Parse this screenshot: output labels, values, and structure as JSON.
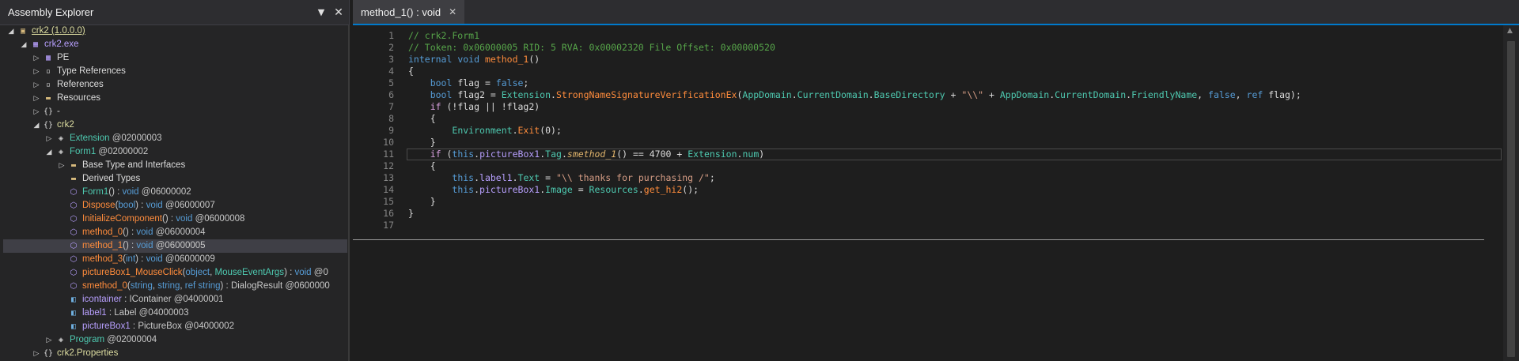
{
  "colors": {
    "background": "#1e1e1e",
    "panel": "#252526",
    "accent": "#007acc",
    "selected_row": "#3f3f46",
    "comment": "#57a64a",
    "keyword": "#569cd6",
    "type": "#4ec9b0",
    "method": "#ff8c3c"
  },
  "explorer": {
    "title": "Assembly Explorer",
    "dropdown_icon": "chevron-down-icon",
    "close_icon": "close-icon",
    "tree": [
      {
        "indent": 0,
        "arrow": "expanded",
        "icon": "assembly-icon",
        "parts": [
          {
            "t": "crk2 (1.0.0.0)",
            "c": "c-yellow u"
          }
        ]
      },
      {
        "indent": 1,
        "arrow": "expanded",
        "icon": "module-icon",
        "parts": [
          {
            "t": "crk2.exe",
            "c": "c-purple"
          }
        ]
      },
      {
        "indent": 2,
        "arrow": "collapsed",
        "icon": "pe-icon",
        "parts": [
          {
            "t": "PE",
            "c": "c-plain"
          }
        ]
      },
      {
        "indent": 2,
        "arrow": "collapsed",
        "icon": "type-ref-icon",
        "parts": [
          {
            "t": "Type References",
            "c": "c-plain"
          }
        ]
      },
      {
        "indent": 2,
        "arrow": "collapsed",
        "icon": "references-icon",
        "parts": [
          {
            "t": "References",
            "c": "c-plain"
          }
        ]
      },
      {
        "indent": 2,
        "arrow": "collapsed",
        "icon": "folder-icon",
        "parts": [
          {
            "t": "Resources",
            "c": "c-plain"
          }
        ]
      },
      {
        "indent": 2,
        "arrow": "collapsed",
        "icon": "namespace-icon",
        "parts": [
          {
            "t": "-",
            "c": "c-plain"
          }
        ]
      },
      {
        "indent": 2,
        "arrow": "expanded",
        "icon": "namespace-icon",
        "parts": [
          {
            "t": "crk2",
            "c": "c-yellow"
          }
        ]
      },
      {
        "indent": 3,
        "arrow": "collapsed",
        "icon": "class-icon",
        "parts": [
          {
            "t": "Extension",
            "c": "c-teal"
          },
          {
            "t": " @02000003",
            "c": "c-grey"
          }
        ]
      },
      {
        "indent": 3,
        "arrow": "expanded",
        "icon": "class-icon",
        "parts": [
          {
            "t": "Form1",
            "c": "c-teal"
          },
          {
            "t": " @02000002",
            "c": "c-grey"
          }
        ]
      },
      {
        "indent": 4,
        "arrow": "collapsed",
        "icon": "folder-icon",
        "parts": [
          {
            "t": "Base Type and Interfaces",
            "c": "c-plain"
          }
        ]
      },
      {
        "indent": 4,
        "arrow": "none",
        "icon": "folder-icon",
        "parts": [
          {
            "t": "Derived Types",
            "c": "c-plain"
          }
        ]
      },
      {
        "indent": 4,
        "arrow": "none",
        "icon": "method-icon",
        "parts": [
          {
            "t": "Form1",
            "c": "c-teal"
          },
          {
            "t": "() : ",
            "c": "c-grey"
          },
          {
            "t": "void",
            "c": "c-blue"
          },
          {
            "t": " @06000002",
            "c": "c-grey"
          }
        ]
      },
      {
        "indent": 4,
        "arrow": "none",
        "icon": "method-icon",
        "parts": [
          {
            "t": "Dispose",
            "c": "c-orange"
          },
          {
            "t": "(",
            "c": "c-grey"
          },
          {
            "t": "bool",
            "c": "c-blue"
          },
          {
            "t": ") : ",
            "c": "c-grey"
          },
          {
            "t": "void",
            "c": "c-blue"
          },
          {
            "t": " @06000007",
            "c": "c-grey"
          }
        ]
      },
      {
        "indent": 4,
        "arrow": "none",
        "icon": "method-icon",
        "parts": [
          {
            "t": "InitializeComponent",
            "c": "c-orange"
          },
          {
            "t": "() : ",
            "c": "c-grey"
          },
          {
            "t": "void",
            "c": "c-blue"
          },
          {
            "t": " @06000008",
            "c": "c-grey"
          }
        ]
      },
      {
        "indent": 4,
        "arrow": "none",
        "icon": "method-icon",
        "parts": [
          {
            "t": "method_0",
            "c": "c-orange"
          },
          {
            "t": "() : ",
            "c": "c-grey"
          },
          {
            "t": "void",
            "c": "c-blue"
          },
          {
            "t": " @06000004",
            "c": "c-grey"
          }
        ]
      },
      {
        "indent": 4,
        "arrow": "none",
        "icon": "method-icon",
        "selected": true,
        "parts": [
          {
            "t": "method_1",
            "c": "c-orange"
          },
          {
            "t": "() : ",
            "c": "c-grey"
          },
          {
            "t": "void",
            "c": "c-blue"
          },
          {
            "t": " @06000005",
            "c": "c-grey"
          }
        ]
      },
      {
        "indent": 4,
        "arrow": "none",
        "icon": "method-icon",
        "parts": [
          {
            "t": "method_3",
            "c": "c-orange"
          },
          {
            "t": "(",
            "c": "c-grey"
          },
          {
            "t": "int",
            "c": "c-blue"
          },
          {
            "t": ") : ",
            "c": "c-grey"
          },
          {
            "t": "void",
            "c": "c-blue"
          },
          {
            "t": " @06000009",
            "c": "c-grey"
          }
        ]
      },
      {
        "indent": 4,
        "arrow": "none",
        "icon": "method-icon",
        "parts": [
          {
            "t": "pictureBox1_MouseClick",
            "c": "c-orange"
          },
          {
            "t": "(",
            "c": "c-grey"
          },
          {
            "t": "object",
            "c": "c-blue"
          },
          {
            "t": ", ",
            "c": "c-grey"
          },
          {
            "t": "MouseEventArgs",
            "c": "c-teal"
          },
          {
            "t": ") : ",
            "c": "c-grey"
          },
          {
            "t": "void",
            "c": "c-blue"
          },
          {
            "t": " @0",
            "c": "c-grey"
          }
        ]
      },
      {
        "indent": 4,
        "arrow": "none",
        "icon": "method-icon",
        "parts": [
          {
            "t": "smethod_0",
            "c": "c-orange"
          },
          {
            "t": "(",
            "c": "c-grey"
          },
          {
            "t": "string",
            "c": "c-blue"
          },
          {
            "t": ", ",
            "c": "c-grey"
          },
          {
            "t": "string",
            "c": "c-blue"
          },
          {
            "t": ", ",
            "c": "c-grey"
          },
          {
            "t": "ref string",
            "c": "c-blue"
          },
          {
            "t": ") : DialogResult @0600000",
            "c": "c-grey"
          }
        ]
      },
      {
        "indent": 4,
        "arrow": "none",
        "icon": "field-icon",
        "parts": [
          {
            "t": "icontainer",
            "c": "c-purple"
          },
          {
            "t": " : IContainer @04000001",
            "c": "c-grey"
          }
        ]
      },
      {
        "indent": 4,
        "arrow": "none",
        "icon": "field-icon",
        "parts": [
          {
            "t": "label1",
            "c": "c-purple"
          },
          {
            "t": " : Label @04000003",
            "c": "c-grey"
          }
        ]
      },
      {
        "indent": 4,
        "arrow": "none",
        "icon": "field-icon",
        "parts": [
          {
            "t": "pictureBox1",
            "c": "c-purple"
          },
          {
            "t": " : PictureBox @04000002",
            "c": "c-grey"
          }
        ]
      },
      {
        "indent": 3,
        "arrow": "collapsed",
        "icon": "class-icon",
        "parts": [
          {
            "t": "Program",
            "c": "c-teal"
          },
          {
            "t": " @02000004",
            "c": "c-grey"
          }
        ]
      },
      {
        "indent": 2,
        "arrow": "collapsed",
        "icon": "namespace-icon",
        "parts": [
          {
            "t": "crk2.Properties",
            "c": "c-yellow"
          }
        ]
      }
    ]
  },
  "editor": {
    "tab_title": "method_1() : void",
    "tab_close_icon": "close-icon",
    "current_line": 11,
    "lines": [
      {
        "n": "1",
        "parts": [
          {
            "t": "// crk2.Form1",
            "c": "c-com"
          }
        ]
      },
      {
        "n": "2",
        "parts": [
          {
            "t": "// Token: 0x06000005 RID: 5 RVA: 0x00002320 File Offset: 0x00000520",
            "c": "c-com"
          }
        ]
      },
      {
        "n": "3",
        "parts": [
          {
            "t": "internal",
            "c": "c-key"
          },
          {
            "t": " ",
            "c": "c-plain"
          },
          {
            "t": "void",
            "c": "c-key"
          },
          {
            "t": " ",
            "c": "c-plain"
          },
          {
            "t": "method_1",
            "c": "c-mname"
          },
          {
            "t": "()",
            "c": "c-plain"
          }
        ]
      },
      {
        "n": "4",
        "parts": [
          {
            "t": "{",
            "c": "c-plain"
          }
        ]
      },
      {
        "n": "5",
        "parts": [
          {
            "t": "    ",
            "c": "c-plain"
          },
          {
            "t": "bool",
            "c": "c-key"
          },
          {
            "t": " flag = ",
            "c": "c-plain"
          },
          {
            "t": "false",
            "c": "c-key"
          },
          {
            "t": ";",
            "c": "c-plain"
          }
        ]
      },
      {
        "n": "6",
        "parts": [
          {
            "t": "    ",
            "c": "c-plain"
          },
          {
            "t": "bool",
            "c": "c-key"
          },
          {
            "t": " flag2 = ",
            "c": "c-plain"
          },
          {
            "t": "Extension",
            "c": "c-type"
          },
          {
            "t": ".",
            "c": "c-plain"
          },
          {
            "t": "StrongNameSignatureVerificationEx",
            "c": "c-mname"
          },
          {
            "t": "(",
            "c": "c-plain"
          },
          {
            "t": "AppDomain",
            "c": "c-type"
          },
          {
            "t": ".",
            "c": "c-plain"
          },
          {
            "t": "CurrentDomain",
            "c": "c-type"
          },
          {
            "t": ".",
            "c": "c-plain"
          },
          {
            "t": "BaseDirectory",
            "c": "c-type"
          },
          {
            "t": " + ",
            "c": "c-plain"
          },
          {
            "t": "\"\\\\\"",
            "c": "c-str"
          },
          {
            "t": " + ",
            "c": "c-plain"
          },
          {
            "t": "AppDomain",
            "c": "c-type"
          },
          {
            "t": ".",
            "c": "c-plain"
          },
          {
            "t": "CurrentDomain",
            "c": "c-type"
          },
          {
            "t": ".",
            "c": "c-plain"
          },
          {
            "t": "FriendlyName",
            "c": "c-type"
          },
          {
            "t": ", ",
            "c": "c-plain"
          },
          {
            "t": "false",
            "c": "c-key"
          },
          {
            "t": ", ",
            "c": "c-plain"
          },
          {
            "t": "ref",
            "c": "c-key"
          },
          {
            "t": " flag);",
            "c": "c-plain"
          }
        ]
      },
      {
        "n": "7",
        "parts": [
          {
            "t": "    ",
            "c": "c-plain"
          },
          {
            "t": "if",
            "c": "c-ctl"
          },
          {
            "t": " (!flag || !flag2)",
            "c": "c-plain"
          }
        ]
      },
      {
        "n": "8",
        "parts": [
          {
            "t": "    {",
            "c": "c-plain"
          }
        ]
      },
      {
        "n": "9",
        "parts": [
          {
            "t": "        ",
            "c": "c-plain"
          },
          {
            "t": "Environment",
            "c": "c-type"
          },
          {
            "t": ".",
            "c": "c-plain"
          },
          {
            "t": "Exit",
            "c": "c-mname"
          },
          {
            "t": "(0);",
            "c": "c-plain"
          }
        ]
      },
      {
        "n": "10",
        "parts": [
          {
            "t": "    }",
            "c": "c-plain"
          }
        ]
      },
      {
        "n": "11",
        "parts": [
          {
            "t": "    ",
            "c": "c-plain"
          },
          {
            "t": "if",
            "c": "c-ctl"
          },
          {
            "t": " (",
            "c": "c-plain"
          },
          {
            "t": "this",
            "c": "c-key"
          },
          {
            "t": ".",
            "c": "c-plain"
          },
          {
            "t": "pictureBox1",
            "c": "c-field"
          },
          {
            "t": ".",
            "c": "c-plain"
          },
          {
            "t": "Tag",
            "c": "c-type"
          },
          {
            "t": ".",
            "c": "c-plain"
          },
          {
            "t": "smethod_1",
            "c": "c-ext"
          },
          {
            "t": "() == 4700 + ",
            "c": "c-plain"
          },
          {
            "t": "Extension",
            "c": "c-type"
          },
          {
            "t": ".",
            "c": "c-plain"
          },
          {
            "t": "num",
            "c": "c-type"
          },
          {
            "t": ")",
            "c": "c-plain"
          }
        ]
      },
      {
        "n": "12",
        "parts": [
          {
            "t": "    {",
            "c": "c-plain"
          }
        ]
      },
      {
        "n": "13",
        "parts": [
          {
            "t": "        ",
            "c": "c-plain"
          },
          {
            "t": "this",
            "c": "c-key"
          },
          {
            "t": ".",
            "c": "c-plain"
          },
          {
            "t": "label1",
            "c": "c-field"
          },
          {
            "t": ".",
            "c": "c-plain"
          },
          {
            "t": "Text",
            "c": "c-type"
          },
          {
            "t": " = ",
            "c": "c-plain"
          },
          {
            "t": "\"\\\\ thanks for purchasing /\"",
            "c": "c-str"
          },
          {
            "t": ";",
            "c": "c-plain"
          }
        ]
      },
      {
        "n": "14",
        "parts": [
          {
            "t": "        ",
            "c": "c-plain"
          },
          {
            "t": "this",
            "c": "c-key"
          },
          {
            "t": ".",
            "c": "c-plain"
          },
          {
            "t": "pictureBox1",
            "c": "c-field"
          },
          {
            "t": ".",
            "c": "c-plain"
          },
          {
            "t": "Image",
            "c": "c-type"
          },
          {
            "t": " = ",
            "c": "c-plain"
          },
          {
            "t": "Resources",
            "c": "c-type"
          },
          {
            "t": ".",
            "c": "c-plain"
          },
          {
            "t": "get_hi2",
            "c": "c-mname"
          },
          {
            "t": "();",
            "c": "c-plain"
          }
        ]
      },
      {
        "n": "15",
        "parts": [
          {
            "t": "    }",
            "c": "c-plain"
          }
        ]
      },
      {
        "n": "16",
        "parts": [
          {
            "t": "}",
            "c": "c-plain"
          }
        ]
      },
      {
        "n": "17",
        "parts": [
          {
            "t": "",
            "c": "c-plain"
          }
        ]
      }
    ]
  }
}
